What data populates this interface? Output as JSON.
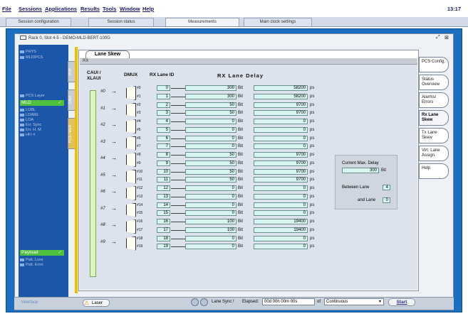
{
  "menu": {
    "items": [
      "File",
      "Sessions",
      "Applications",
      "Results",
      "Tools",
      "Window",
      "Help"
    ],
    "clock": "13:17"
  },
  "tabs": [
    "Session configuration",
    "Session status",
    "Measurements",
    "Main clock settings"
  ],
  "frame": {
    "title": "Rack 0, Slot 4-5 - DEMO-MLD-BERT-100G"
  },
  "left_nav": {
    "top_items": [
      "PHYS",
      "MLD/PCS"
    ],
    "pcs_label": "PCS Layer",
    "mld": "MLD",
    "mld_items": [
      "LOBL",
      "LOAML",
      "LOA",
      "Err. Sync",
      "Err. H. M",
      "HFI #"
    ],
    "payload": "Payload",
    "payload_items": [
      "Patt. Loss",
      "Patt. Error"
    ],
    "interface": "Interface"
  },
  "vtabs": [
    "PHY",
    "CAUI",
    "PCS / MLD"
  ],
  "lane_tab": "Lane Skew",
  "rx_bar": "RX",
  "headers": {
    "caui": "CAUI / XLAUI",
    "dmux": "DMUX",
    "rx_lane_id": "RX Lane ID",
    "rx_lane_delay": "RX  Lane  Delay"
  },
  "groups": [
    "#0",
    "#1",
    "#2",
    "#3",
    "#4",
    "#5",
    "#6",
    "#7",
    "#8",
    "#9"
  ],
  "lanes": [
    {
      "out": "#0",
      "id": "0",
      "bit": "300",
      "ps": "58200"
    },
    {
      "out": "#1",
      "id": "1",
      "bit": "300",
      "ps": "58200"
    },
    {
      "out": "#2",
      "id": "2",
      "bit": "50",
      "ps": "9700"
    },
    {
      "out": "#3",
      "id": "3",
      "bit": "50",
      "ps": "9700"
    },
    {
      "out": "#4",
      "id": "4",
      "bit": "0",
      "ps": "0"
    },
    {
      "out": "#5",
      "id": "5",
      "bit": "0",
      "ps": "0"
    },
    {
      "out": "#6",
      "id": "6",
      "bit": "0",
      "ps": "0"
    },
    {
      "out": "#7",
      "id": "7",
      "bit": "0",
      "ps": "0"
    },
    {
      "out": "#8",
      "id": "8",
      "bit": "50",
      "ps": "9700"
    },
    {
      "out": "#9",
      "id": "9",
      "bit": "50",
      "ps": "9700"
    },
    {
      "out": "#10",
      "id": "10",
      "bit": "50",
      "ps": "9700"
    },
    {
      "out": "#11",
      "id": "11",
      "bit": "50",
      "ps": "9700"
    },
    {
      "out": "#12",
      "id": "12",
      "bit": "0",
      "ps": "0"
    },
    {
      "out": "#13",
      "id": "13",
      "bit": "0",
      "ps": "0"
    },
    {
      "out": "#14",
      "id": "14",
      "bit": "0",
      "ps": "0"
    },
    {
      "out": "#15",
      "id": "15",
      "bit": "0",
      "ps": "0"
    },
    {
      "out": "#16",
      "id": "16",
      "bit": "100",
      "ps": "19400"
    },
    {
      "out": "#17",
      "id": "17",
      "bit": "100",
      "ps": "19400"
    },
    {
      "out": "#18",
      "id": "18",
      "bit": "0",
      "ps": "0"
    },
    {
      "out": "#19",
      "id": "19",
      "bit": "0",
      "ps": "0"
    }
  ],
  "units": {
    "bit": "Bit",
    "ps": "ps"
  },
  "summary": {
    "label": "Current Max. Delay",
    "value": "300",
    "unit": "Bit",
    "between_label": "Between  Lane",
    "lane_a": "4",
    "and_label": "and Lane",
    "lane_b": "0"
  },
  "side_buttons": [
    "PCS Config.",
    "Status Overview",
    "Alarms/ Errors",
    "Rx Lane Skew",
    "Tx Lane Skew",
    "Virt. Lane Assign.",
    "Help"
  ],
  "statusbar": {
    "laser": "Laser",
    "sync": "Lane Sync !",
    "elapsed_label": "Elapsed:",
    "elapsed": "00d 00h 00m 00s",
    "of": "of",
    "mode": "Continuous",
    "start": "Start"
  }
}
